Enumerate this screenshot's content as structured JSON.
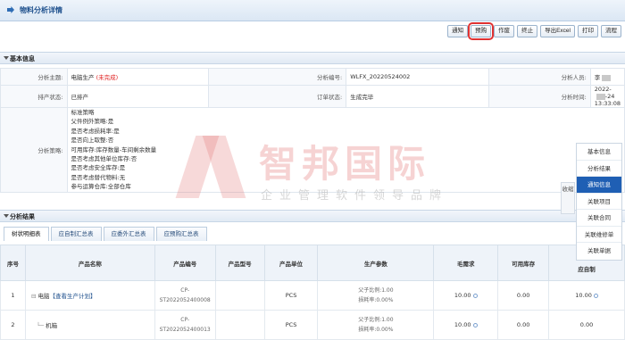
{
  "header": {
    "title": "物料分析详情"
  },
  "toolbar": {
    "buttons": [
      "通知",
      "预购",
      "作废",
      "终止",
      "导出Excel",
      "打印",
      "流程"
    ]
  },
  "basic_info": {
    "section_title": "基本信息",
    "topic_label": "分析主题:",
    "topic_value": "电脑生产",
    "topic_status": "(未完成)",
    "number_label": "分析编号:",
    "number_value": "WLFX_20220524002",
    "analyst_label": "分析人员:",
    "analyst_value": "李",
    "schedule_label": "排产状态:",
    "schedule_value": "已排产",
    "order_label": "订单状态:",
    "order_value": "生成完毕",
    "time_label": "分析时间:",
    "time_prefix": "2022-",
    "time_suffix": "-24 13:33:08",
    "policy_label": "分析策略:",
    "policy_lines": [
      "标准策略",
      "父件例外策略:是",
      "是否考虑损耗率:是",
      "是否向上取整:否",
      "可用库存:库存数量-车间剩余数量",
      "是否考虑其他单位库存:否",
      "是否考虑安全库存:是",
      "是否考虑替代物料:无",
      "参与运算仓库:全部仓库"
    ]
  },
  "watermark": {
    "main": "智邦国际",
    "sub": "企业管理软件领导品牌"
  },
  "results": {
    "section_title": "分析结果",
    "tabs": [
      "树状明细表",
      "应自制汇总表",
      "应委外汇总表",
      "应预购汇总表"
    ],
    "columns": [
      "序号",
      "产品名称",
      "产品编号",
      "产品型号",
      "产品单位",
      "生产参数",
      "毛需求",
      "可用库存",
      "应自制"
    ],
    "rows": [
      {
        "index": "1",
        "name": "电脑",
        "link": "【查看生产计划】",
        "code_top": "CP-",
        "code_bottom": "ST2022052400008",
        "model": "",
        "unit": "PCS",
        "param1": "父子比例:1.00",
        "param2": "损耗率:0.00%",
        "gross": "10.00",
        "stock": "0.00",
        "self": "10.00"
      },
      {
        "index": "2",
        "name": "机箱",
        "link": "",
        "code_top": "CP-",
        "code_bottom": "ST2022052400013",
        "model": "",
        "unit": "PCS",
        "param1": "父子比例:1.00",
        "param2": "损耗率:0.00%",
        "gross": "10.00",
        "stock": "0.00",
        "self": "0.00"
      }
    ]
  },
  "side": {
    "collapse_label": "收缩",
    "menu": [
      "基本信息",
      "分析结果",
      "通知信息",
      "关联项目",
      "关联合同",
      "关联维修单",
      "关联单据"
    ],
    "active_index": 2
  }
}
